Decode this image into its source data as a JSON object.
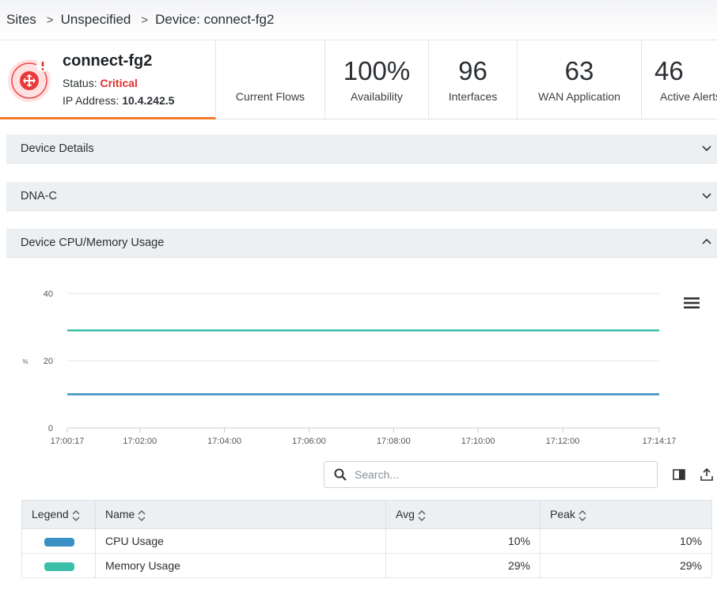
{
  "breadcrumb": {
    "items": [
      "Sites",
      "Unspecified",
      "Device: connect-fg2"
    ],
    "separator": ">"
  },
  "device": {
    "name": "connect-fg2",
    "status_label": "Status:",
    "status_value": "Critical",
    "ip_label": "IP Address:",
    "ip_value": "10.4.242.5"
  },
  "metrics": [
    {
      "value": "",
      "label": "Current Flows"
    },
    {
      "value": "100%",
      "label": "Availability"
    },
    {
      "value": "96",
      "label": "Interfaces"
    },
    {
      "value": "63",
      "label": "WAN Application"
    },
    {
      "value": "46",
      "label": "Active Alerts"
    }
  ],
  "sections": {
    "device_details": "Device Details",
    "dnac": "DNA-C",
    "cpu_memory": "Device CPU/Memory Usage"
  },
  "chart_data": {
    "type": "line",
    "title": "",
    "xlabel": "",
    "ylabel": "%",
    "x_ticks": [
      "17:00:17",
      "17:02:00",
      "17:04:00",
      "17:06:00",
      "17:08:00",
      "17:10:00",
      "17:12:00",
      "17:14:17"
    ],
    "y_ticks": [
      0,
      20,
      40
    ],
    "ylim": [
      0,
      40
    ],
    "grid": true,
    "x": [
      "17:00:17",
      "17:14:17"
    ],
    "series": [
      {
        "name": "CPU Usage",
        "values": [
          10,
          10
        ],
        "color": "#3a8fc4"
      },
      {
        "name": "Memory Usage",
        "values": [
          29,
          29
        ],
        "color": "#3bbfa9"
      }
    ]
  },
  "search": {
    "placeholder": "Search..."
  },
  "table": {
    "headers": [
      "Legend",
      "Name",
      "Avg",
      "Peak"
    ],
    "rows": [
      {
        "name": "CPU Usage",
        "avg": "10%",
        "peak": "10%",
        "color": "#3a8fc4"
      },
      {
        "name": "Memory Usage",
        "avg": "29%",
        "peak": "29%",
        "color": "#3bbfa9"
      }
    ]
  },
  "colors": {
    "accent_orange": "#f07a2d",
    "critical_red": "#e52b2b"
  }
}
